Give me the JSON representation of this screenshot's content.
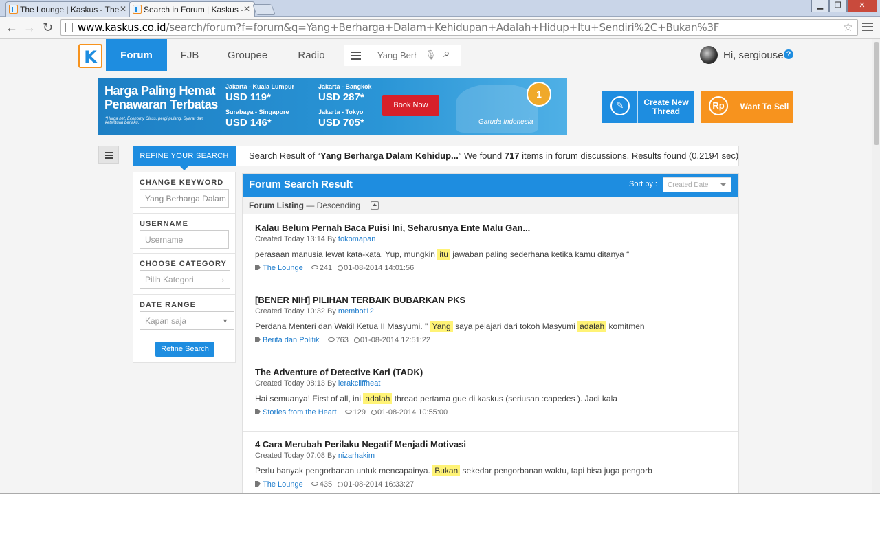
{
  "browser": {
    "tabs": [
      {
        "title": "The Lounge | Kaskus - The"
      },
      {
        "title": "Search in Forum | Kaskus -"
      }
    ],
    "url_host": "www.kaskus.co.id",
    "url_path": "/search/forum?f=forum&q=Yang+Berharga+Dalam+Kehidupan+Adalah+Hidup+Itu+Sendiri%2C+Bukan%3F"
  },
  "nav": {
    "items": [
      "Forum",
      "FJB",
      "Groupee",
      "Radio"
    ],
    "search_value": "Yang Berh",
    "greeting": "Hi, sergiouse"
  },
  "banner": {
    "headline": "Harga Paling Hemat Penawaran Terbatas",
    "note": "*Harga net, Economy Class, pergi-pulang. Syarat dan ketentuan berlaku.",
    "routes": [
      {
        "route": "Jakarta - Kuala Lumpur",
        "price": "USD 119*"
      },
      {
        "route": "Surabaya - Singapore",
        "price": "USD 146*"
      },
      {
        "route": "Jakarta - Bangkok",
        "price": "USD 287*"
      },
      {
        "route": "Jakarta - Tokyo",
        "price": "USD 705*"
      }
    ],
    "cta": "Book Now",
    "brand": "Garuda Indonesia",
    "medal": "1"
  },
  "actions": {
    "create_thread": "Create New Thread",
    "want_to_sell": "Want To Sell",
    "rp_symbol": "Rp"
  },
  "refine": {
    "tab_label": "REFINE YOUR SEARCH",
    "keyword_label": "CHANGE KEYWORD",
    "keyword_value": "Yang Berharga Dalam",
    "username_label": "USERNAME",
    "username_placeholder": "Username",
    "category_label": "CHOOSE CATEGORY",
    "category_placeholder": "Pilih Kategori",
    "daterange_label": "DATE RANGE",
    "daterange_value": "Kapan saja",
    "button": "Refine Search"
  },
  "summary": {
    "prefix": "Search Result of “",
    "query": "Yang Berharga Dalam Kehidup...",
    "middle": "” We found ",
    "count": "717",
    "suffix": " items in forum discussions. Results found (0.2194 sec)"
  },
  "results": {
    "title": "Forum Search Result",
    "sort_label": "Sort by :",
    "sort_value": "Created Date",
    "listing_label": "Forum Listing",
    "listing_order": "— Descending",
    "items": [
      {
        "title": "Kalau Belum Pernah Baca Puisi Ini, Seharusnya Ente Malu Gan...",
        "created": "Created Today 13:14 By ",
        "author": "tokomapan",
        "snip_a": "perasaan manusia lewat kata-kata. Yup, mungkin ",
        "hl1": "itu",
        "snip_b": " jawaban paling sederhana ketika kamu ditanya “",
        "hl2": "",
        "snip_c": "",
        "category": "The Lounge",
        "views": "241",
        "date": "01-08-2014 14:01:56"
      },
      {
        "title": "[BENER NIH] PILIHAN TERBAIK BUBARKAN PKS",
        "created": "Created Today 10:32 By ",
        "author": "membot12",
        "snip_a": "Perdana Menteri dan Wakil Ketua II Masyumi. \" ",
        "hl1": "Yang",
        "snip_b": " saya pelajari dari tokoh Masyumi ",
        "hl2": "adalah",
        "snip_c": " komitmen",
        "category": "Berita dan Politik",
        "views": "763",
        "date": "01-08-2014 12:51:22"
      },
      {
        "title": "The Adventure of Detective Karl (TADK)",
        "created": "Created Today 08:13 By ",
        "author": "lerakcliffheat",
        "snip_a": "Hai semuanya! First of all, ini ",
        "hl1": "adalah",
        "snip_b": " thread pertama gue di kaskus (seriusan :capedes ). Jadi kala",
        "hl2": "",
        "snip_c": "",
        "category": "Stories from the Heart",
        "views": "129",
        "date": "01-08-2014 10:55:00"
      },
      {
        "title": "4 Cara Merubah Perilaku Negatif Menjadi Motivasi",
        "created": "Created Today 07:08 By ",
        "author": "nizarhakim",
        "snip_a": "Perlu banyak pengorbanan untuk mencapainya. ",
        "hl1": "Bukan",
        "snip_b": " sekedar pengorbanan waktu, tapi bisa juga pengorb",
        "hl2": "",
        "snip_c": "",
        "category": "The Lounge",
        "views": "435",
        "date": "01-08-2014 16:33:27"
      }
    ]
  },
  "colors": {
    "brand_blue": "#1e8de0",
    "orange": "#f7931e",
    "highlight": "#fff376"
  }
}
